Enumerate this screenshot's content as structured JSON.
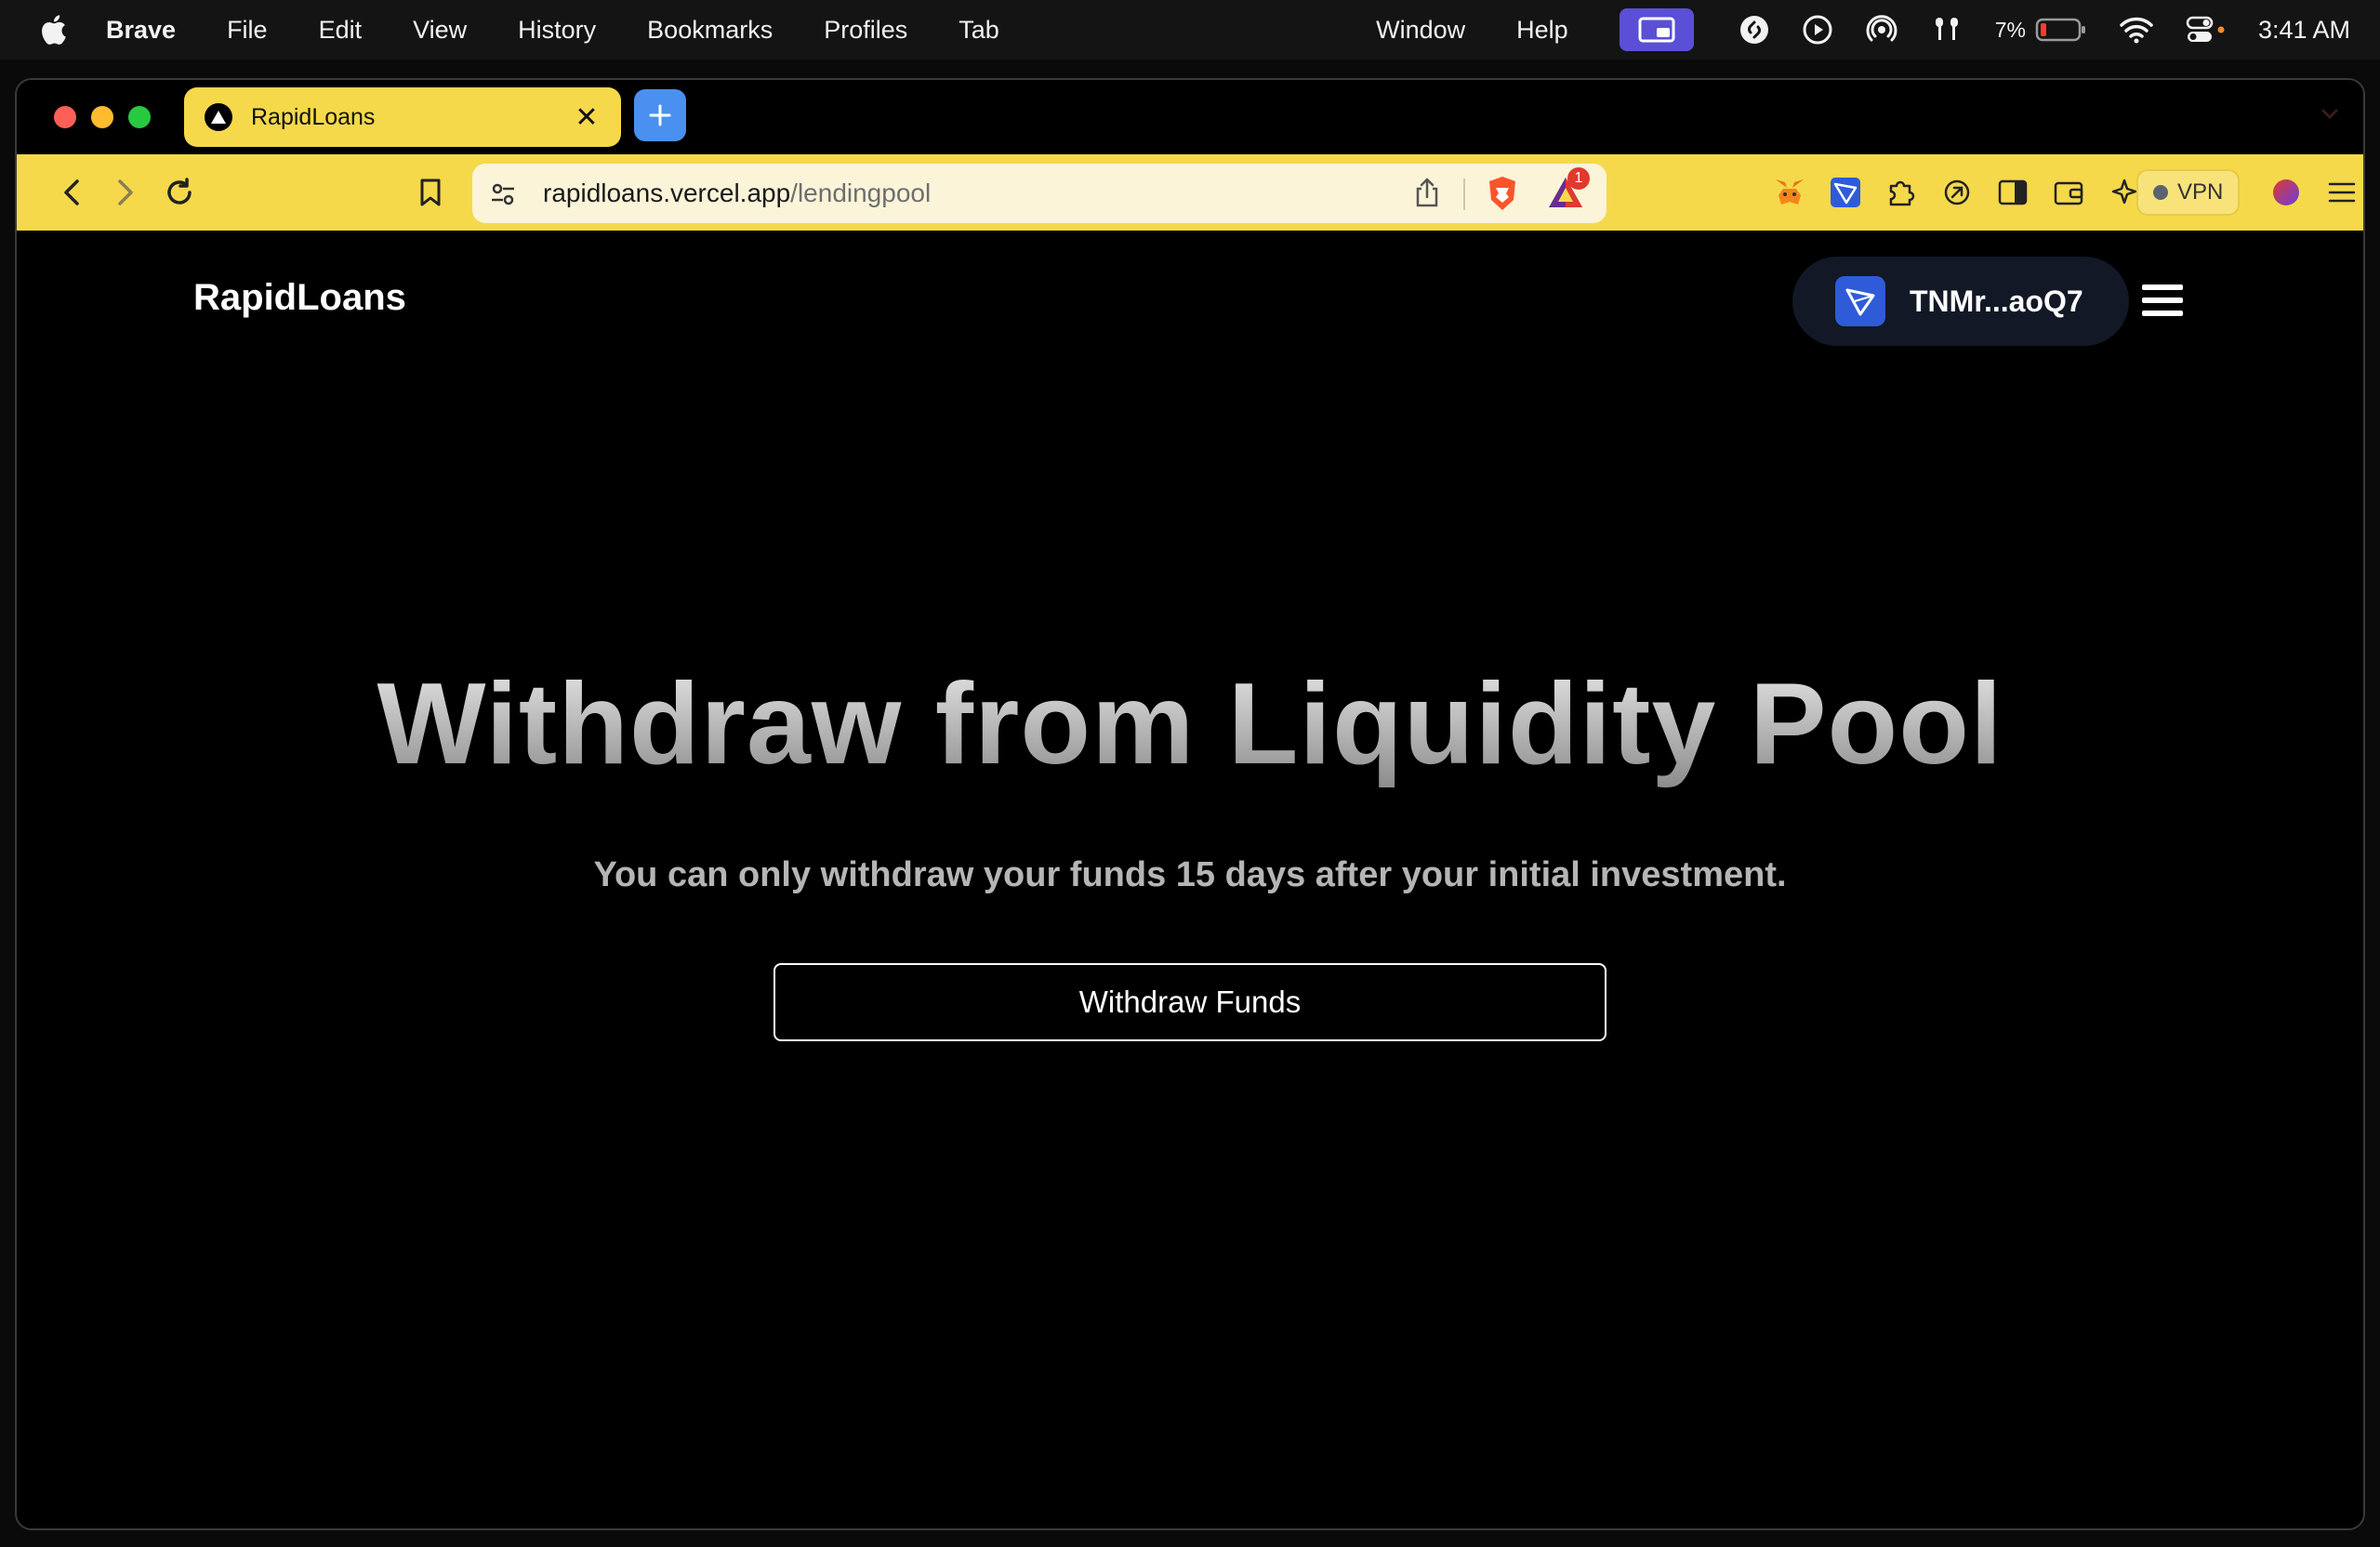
{
  "menubar": {
    "app_name": "Brave",
    "items": [
      "File",
      "Edit",
      "View",
      "History",
      "Bookmarks",
      "Profiles",
      "Tab"
    ],
    "right_items": [
      "Window",
      "Help"
    ],
    "battery_percent": "7%",
    "time": "3:41 AM"
  },
  "browser": {
    "tab_title": "RapidLoans",
    "url_host": "rapidloans.vercel.app",
    "url_path": "/lendingpool",
    "rewards_badge": "1",
    "vpn_label": "VPN",
    "accent_color": "#f5d94a"
  },
  "page": {
    "brand": "RapidLoans",
    "wallet_address": "TNMr...aoQ7",
    "title": "Withdraw from Liquidity Pool",
    "subtitle": "You can only withdraw your funds 15 days after your initial investment.",
    "withdraw_button": "Withdraw Funds"
  }
}
